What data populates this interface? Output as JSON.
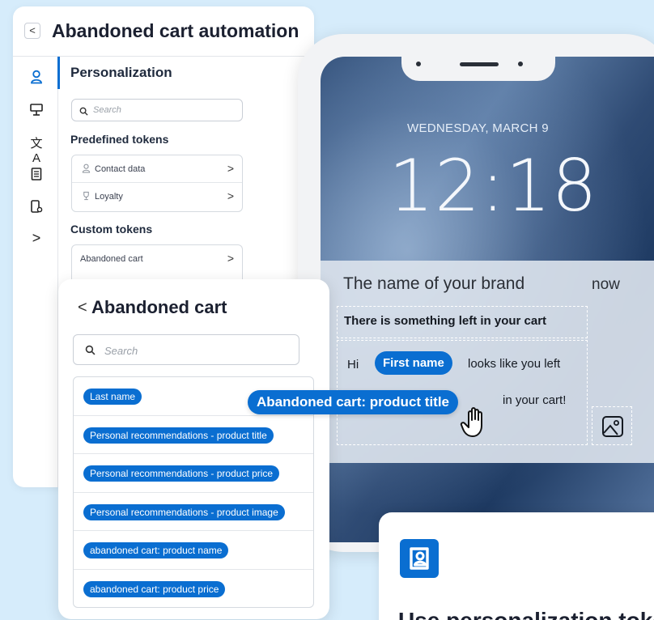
{
  "back_panel": {
    "title": "Abandoned cart automation",
    "back_glyph": "<",
    "rail_icons": [
      "person-icon",
      "board-icon",
      "translate-icon",
      "document-icon",
      "device-settings-icon",
      "chevron-right-icon"
    ],
    "section_title": "Personalization",
    "search_placeholder": "Search",
    "predefined_title": "Predefined tokens",
    "predefined_tokens": [
      {
        "label": "Contact data",
        "icon": "person-icon"
      },
      {
        "label": "Loyalty",
        "icon": "trophy-icon"
      }
    ],
    "custom_title": "Custom tokens",
    "custom_tokens": [
      {
        "label": "Abandoned cart"
      }
    ]
  },
  "front_panel": {
    "back_glyph": "<",
    "title": "Abandoned cart",
    "search_placeholder": "Search",
    "tokens": [
      "Last name",
      "Personal recommendations - product title",
      "Personal recommendations - product price",
      "Personal recommendations - product image",
      "abandoned cart: product name",
      "abandoned cart: product price"
    ]
  },
  "phone": {
    "date": "WEDNESDAY, MARCH 9",
    "time": "12:18",
    "notification": {
      "brand": "The name of your brand",
      "when": "now",
      "title": "There is something left in your cart",
      "greeting": "Hi",
      "first_name_chip": "First name",
      "body_after_chip": "looks like you left",
      "body_end": "in your cart!"
    }
  },
  "drag_chip": "Abandoned cart: product title",
  "feature_card": {
    "icon": "contact-card-icon",
    "text": "Use personalization tokens"
  },
  "colors": {
    "background": "#d6ecfb",
    "accent": "#0a6ed1",
    "panel": "#ffffff"
  }
}
